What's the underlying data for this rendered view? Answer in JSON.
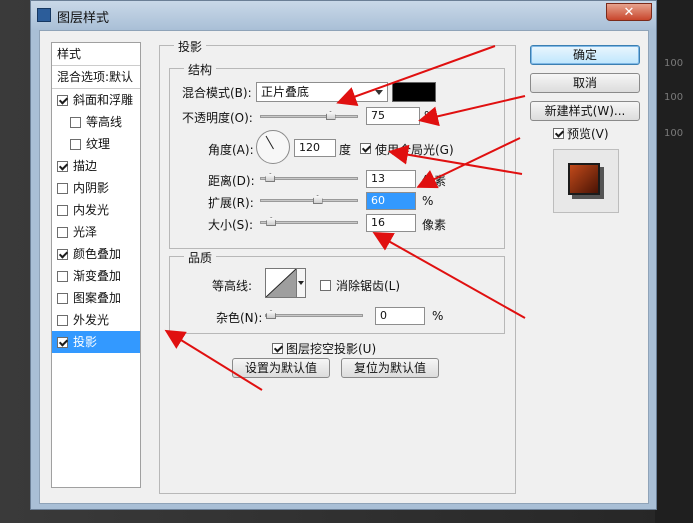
{
  "dialog": {
    "title": "图层样式",
    "close_glyph": "✕"
  },
  "style_list": {
    "header": "样式",
    "blend_options": "混合选项:默认",
    "items": [
      {
        "label": "斜面和浮雕",
        "checked": true,
        "indent": false
      },
      {
        "label": "等高线",
        "checked": false,
        "indent": true
      },
      {
        "label": "纹理",
        "checked": false,
        "indent": true
      },
      {
        "label": "描边",
        "checked": true,
        "indent": false
      },
      {
        "label": "内阴影",
        "checked": false,
        "indent": false
      },
      {
        "label": "内发光",
        "checked": false,
        "indent": false
      },
      {
        "label": "光泽",
        "checked": false,
        "indent": false
      },
      {
        "label": "颜色叠加",
        "checked": true,
        "indent": false
      },
      {
        "label": "渐变叠加",
        "checked": false,
        "indent": false
      },
      {
        "label": "图案叠加",
        "checked": false,
        "indent": false
      },
      {
        "label": "外发光",
        "checked": false,
        "indent": false
      },
      {
        "label": "投影",
        "checked": true,
        "indent": false,
        "selected": true
      }
    ]
  },
  "drop_shadow": {
    "title": "投影",
    "structure": {
      "title": "结构",
      "blend_mode_label": "混合模式(B):",
      "blend_mode_value": "正片叠底",
      "opacity_label": "不透明度(O):",
      "opacity_value": "75",
      "opacity_unit": "%",
      "opacity_level": 0.75,
      "angle_label": "角度(A):",
      "angle_value": "120",
      "angle_unit": "度",
      "global_light_label": "使用全局光(G)",
      "distance_label": "距离(D):",
      "distance_value": "13",
      "distance_unit": "像素",
      "distance_level": 0.05,
      "spread_label": "扩展(R):",
      "spread_value": "60",
      "spread_unit": "%",
      "spread_level": 0.6,
      "size_label": "大小(S):",
      "size_value": "16",
      "size_unit": "像素",
      "size_level": 0.06,
      "shadow_color": "#000000"
    },
    "quality": {
      "title": "品质",
      "contour_label": "等高线:",
      "anti_alias_label": "消除锯齿(L)",
      "noise_label": "杂色(N):",
      "noise_value": "0",
      "noise_unit": "%",
      "noise_level": 0
    },
    "knockout_label": "图层挖空投影(U)",
    "make_default": "设置为默认值",
    "reset_default": "复位为默认值"
  },
  "buttons": {
    "ok": "确定",
    "cancel": "取消",
    "new_style": "新建样式(W)...",
    "preview_label": "预览(V)"
  },
  "background": {
    "right_labels": [
      "100",
      "100",
      "100"
    ]
  }
}
